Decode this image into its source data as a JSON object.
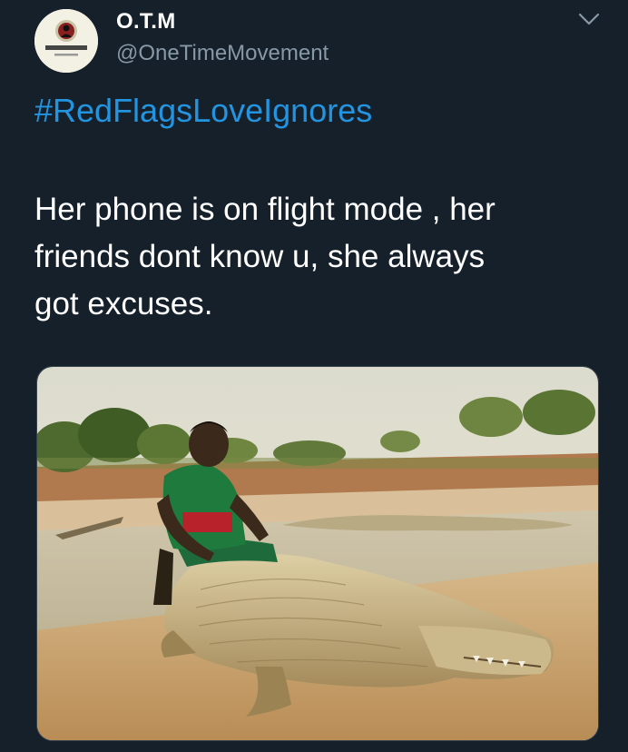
{
  "tweet": {
    "author": {
      "display_name": "O.T.M",
      "handle": "@OneTimeMovement",
      "avatar_icon": "one-time-movement-logo"
    },
    "menu_icon": "chevron-down-icon",
    "hashtag": "#RedFlagsLoveIgnores",
    "text_lines": [
      "Her phone is on flight mode , her",
      "friends dont know u, she always",
      "got excuses."
    ],
    "media": {
      "kind": "photo"
    }
  },
  "colors": {
    "background": "#15202b",
    "primary_text": "#ffffff",
    "secondary_text": "#8899a6",
    "link": "#2394e0",
    "border": "#38444d"
  }
}
